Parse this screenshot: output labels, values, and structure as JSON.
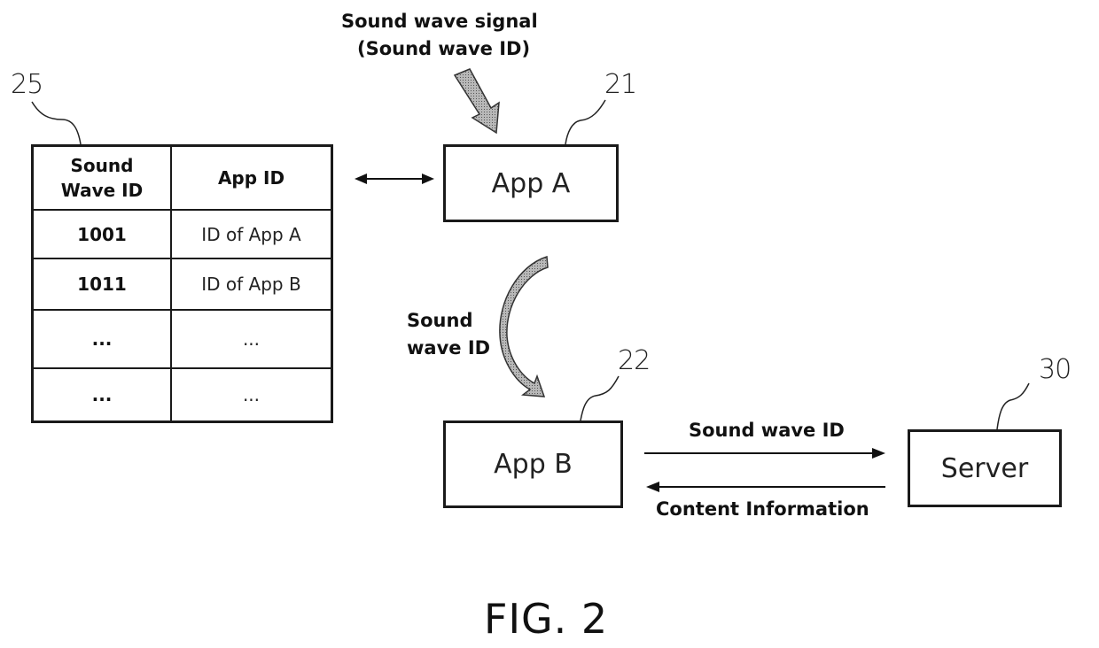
{
  "figure": {
    "caption": "FIG. 2"
  },
  "reference_numerals": {
    "table": "25",
    "app_a": "21",
    "app_b": "22",
    "server": "30"
  },
  "mapping_table": {
    "headers": [
      "Sound\nWave ID",
      "App ID"
    ],
    "header_lines": {
      "col1_line1": "Sound",
      "col1_line2": "Wave ID",
      "col2": "App ID"
    },
    "rows": [
      {
        "sound_wave_id": "1001",
        "app_id": "ID of App A"
      },
      {
        "sound_wave_id": "1011",
        "app_id": "ID of App B"
      },
      {
        "sound_wave_id": "...",
        "app_id": "..."
      },
      {
        "sound_wave_id": "...",
        "app_id": "..."
      }
    ]
  },
  "nodes": {
    "app_a": "App A",
    "app_b": "App B",
    "server": "Server"
  },
  "labels": {
    "incoming_signal_line1": "Sound wave signal",
    "incoming_signal_line2": "(Sound wave ID)",
    "transfer_line1": "Sound",
    "transfer_line2": "wave ID",
    "to_server": "Sound wave ID",
    "from_server": "Content Information"
  },
  "colors": {
    "line": "#1a1a1a",
    "arrow_fill": "#9a9a9a"
  }
}
